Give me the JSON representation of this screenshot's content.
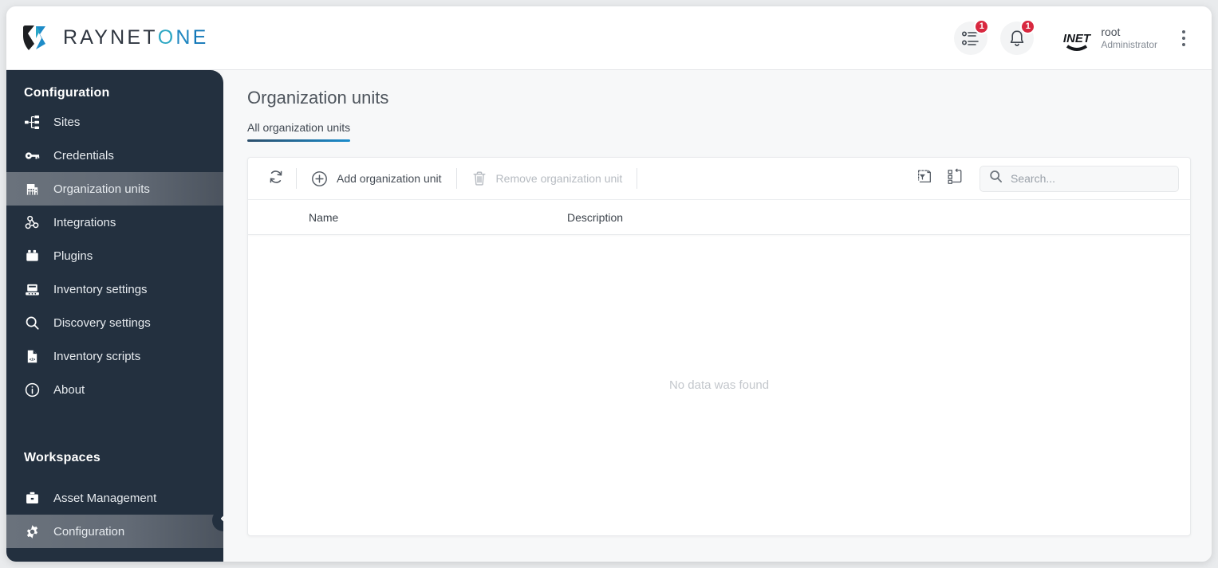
{
  "app": {
    "brand": {
      "part1": "RAYNET",
      "o": "O",
      "n": "N",
      "e": "E",
      "logo_icon": "raynet-logo-mark"
    }
  },
  "header": {
    "tasks": {
      "icon": "task-list-icon",
      "badge": "1"
    },
    "notifications": {
      "icon": "bell-icon",
      "badge": "1"
    },
    "avatar_icon": "net-company-avatar",
    "user_name": "root",
    "user_role": "Administrator",
    "overflow_icon": "kebab-menu-icon"
  },
  "sidebar": {
    "sections": [
      {
        "title": "Configuration",
        "items": [
          {
            "label": "Sites",
            "icon": "sitemap-icon",
            "active": false
          },
          {
            "label": "Credentials",
            "icon": "key-icon",
            "active": false
          },
          {
            "label": "Organization units",
            "icon": "building-icon",
            "active": true
          },
          {
            "label": "Integrations",
            "icon": "webhook-icon",
            "active": false
          },
          {
            "label": "Plugins",
            "icon": "plugin-icon",
            "active": false
          },
          {
            "label": "Inventory settings",
            "icon": "server-icon",
            "active": false
          },
          {
            "label": "Discovery settings",
            "icon": "search-icon",
            "active": false
          },
          {
            "label": "Inventory scripts",
            "icon": "script-file-icon",
            "active": false
          },
          {
            "label": "About",
            "icon": "info-circle-icon",
            "active": false
          }
        ]
      },
      {
        "title": "Workspaces",
        "items": [
          {
            "label": "Asset Management",
            "icon": "briefcase-icon",
            "active": false
          },
          {
            "label": "Configuration",
            "icon": "gear-icon",
            "active": true
          }
        ]
      }
    ],
    "collapse_icon": "chevron-left-icon"
  },
  "main": {
    "page_title": "Organization units",
    "tabs": [
      {
        "label": "All organization units",
        "active": true
      }
    ],
    "toolbar": {
      "refresh_icon": "refresh-icon",
      "add_label": "Add organization unit",
      "add_icon": "plus-circle-icon",
      "remove_label": "Remove organization unit",
      "remove_icon": "trash-icon",
      "remove_disabled": true,
      "filter_icon": "filter-page-icon",
      "group_icon": "grouping-icon"
    },
    "search": {
      "placeholder": "Search...",
      "value": "",
      "icon": "search-icon"
    },
    "table": {
      "columns": [
        "Name",
        "Description"
      ],
      "rows": [],
      "empty_message": "No data was found"
    }
  },
  "colors": {
    "sidebar_bg": "#23303f",
    "accent": "#1a8ccc",
    "badge": "#d8283f",
    "brand_dark": "#2f3640"
  }
}
